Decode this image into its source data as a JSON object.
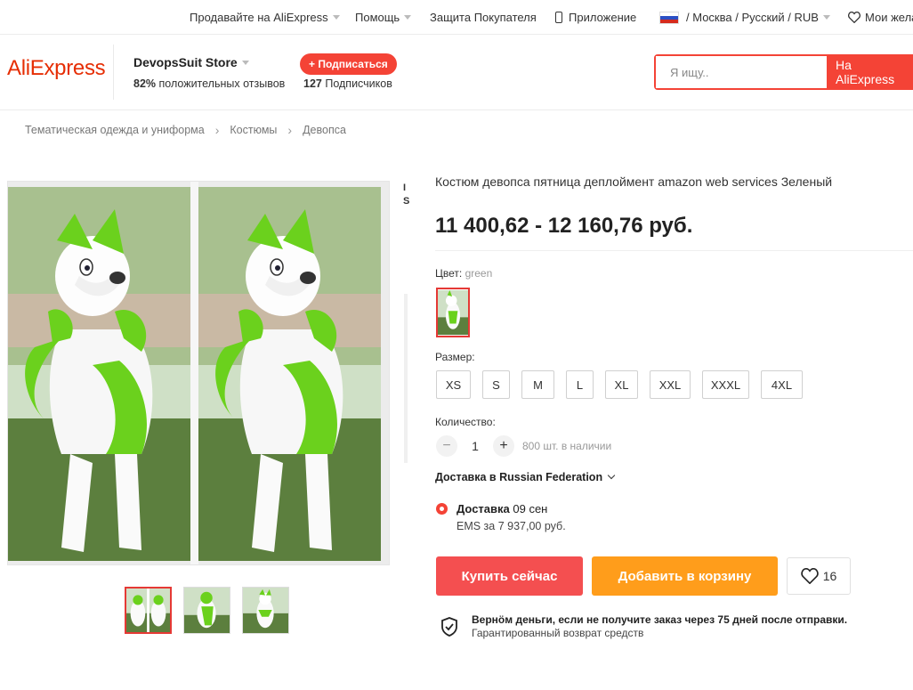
{
  "topbar": {
    "sell": "Продавайте на AliExpress",
    "help": "Помощь",
    "protection": "Защита Покупателя",
    "app": "Приложение",
    "locale": "/ Москва / Русский / RUB",
    "wishlist": "Мои жела"
  },
  "header": {
    "logo": "AliExpress",
    "store_name": "DevopsSuit Store",
    "rating_value": "82%",
    "rating_label": "положительных отзывов",
    "subscribe_label": "+ Подписаться",
    "subscribers_count": "127",
    "subscribers_label": "Подписчиков",
    "search_placeholder": "Я ищу..",
    "search_button": "На AliExpress",
    "accent_color": "#f44336"
  },
  "breadcrumb": [
    "Тематическая одежда и униформа",
    "Костюмы",
    "Девопса"
  ],
  "gallery": {
    "edge_text_1": "I",
    "edge_text_2": "S",
    "thumbnail_count": 3,
    "active_thumbnail": 1
  },
  "product": {
    "title": "Костюм девопса пятница деплоймент amazon web services Зеленый",
    "price": "11 400,62 - 12 160,76 руб.",
    "color_label": "Цвет:",
    "color_value": "green",
    "size_label": "Размер:",
    "sizes": [
      "XS",
      "S",
      "M",
      "L",
      "XL",
      "XXL",
      "XXXL",
      "4XL"
    ],
    "quantity_label": "Количество:",
    "quantity_minus": "−",
    "quantity_value": "1",
    "quantity_plus": "+",
    "stock": "800 шт. в наличии",
    "shipping_to": "Доставка в Russian Federation",
    "delivery_label": "Доставка",
    "delivery_date": "09 сен",
    "delivery_method": "EMS за 7 937,00 руб.",
    "buy_now": "Купить сейчас",
    "add_to_cart": "Добавить в корзину",
    "wishlist_count": "16",
    "guarantee_title": "Вернӧм деньги, если не получите заказ через 75 дней после отправки.",
    "guarantee_sub": "Гарантированный возврат средств",
    "buy_color": "#f44f50",
    "cart_color": "#ff9d1b"
  }
}
